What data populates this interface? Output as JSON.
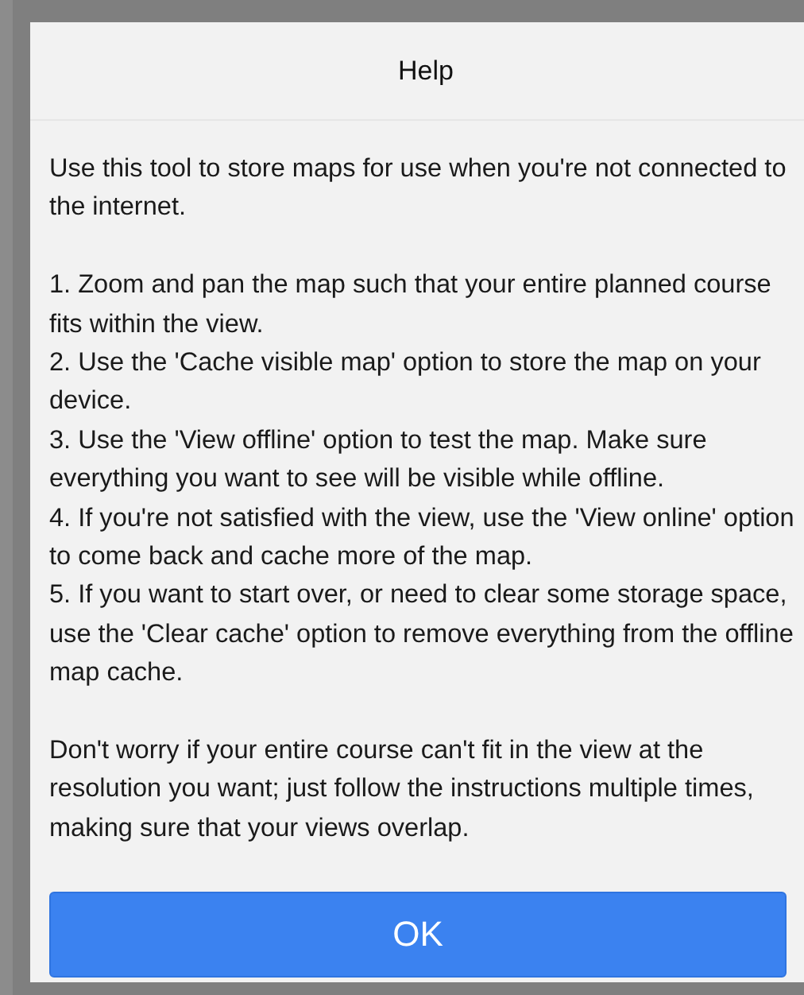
{
  "dialog": {
    "title": "Help",
    "intro": "Use this tool to store maps for use when you're not connected to the internet.",
    "steps": [
      "1. Zoom and pan the map such that your entire planned course fits within the view.",
      "2. Use the 'Cache visible map' option to store the map on your device.",
      "3. Use the 'View offline' option to test the map. Make sure everything you want to see will be visible while offline.",
      "4. If you're not satisfied with the view, use the 'View online' option to come back and cache more of the map.",
      "5. If you want to start over, or need to clear some storage space, use the 'Clear cache' option to remove everything from the offline map cache."
    ],
    "note": "Don't worry if your entire course can't fit in the view at the resolution you want; just follow the instructions multiple times, making sure that your views overlap.",
    "buttons": [
      "OK"
    ]
  }
}
